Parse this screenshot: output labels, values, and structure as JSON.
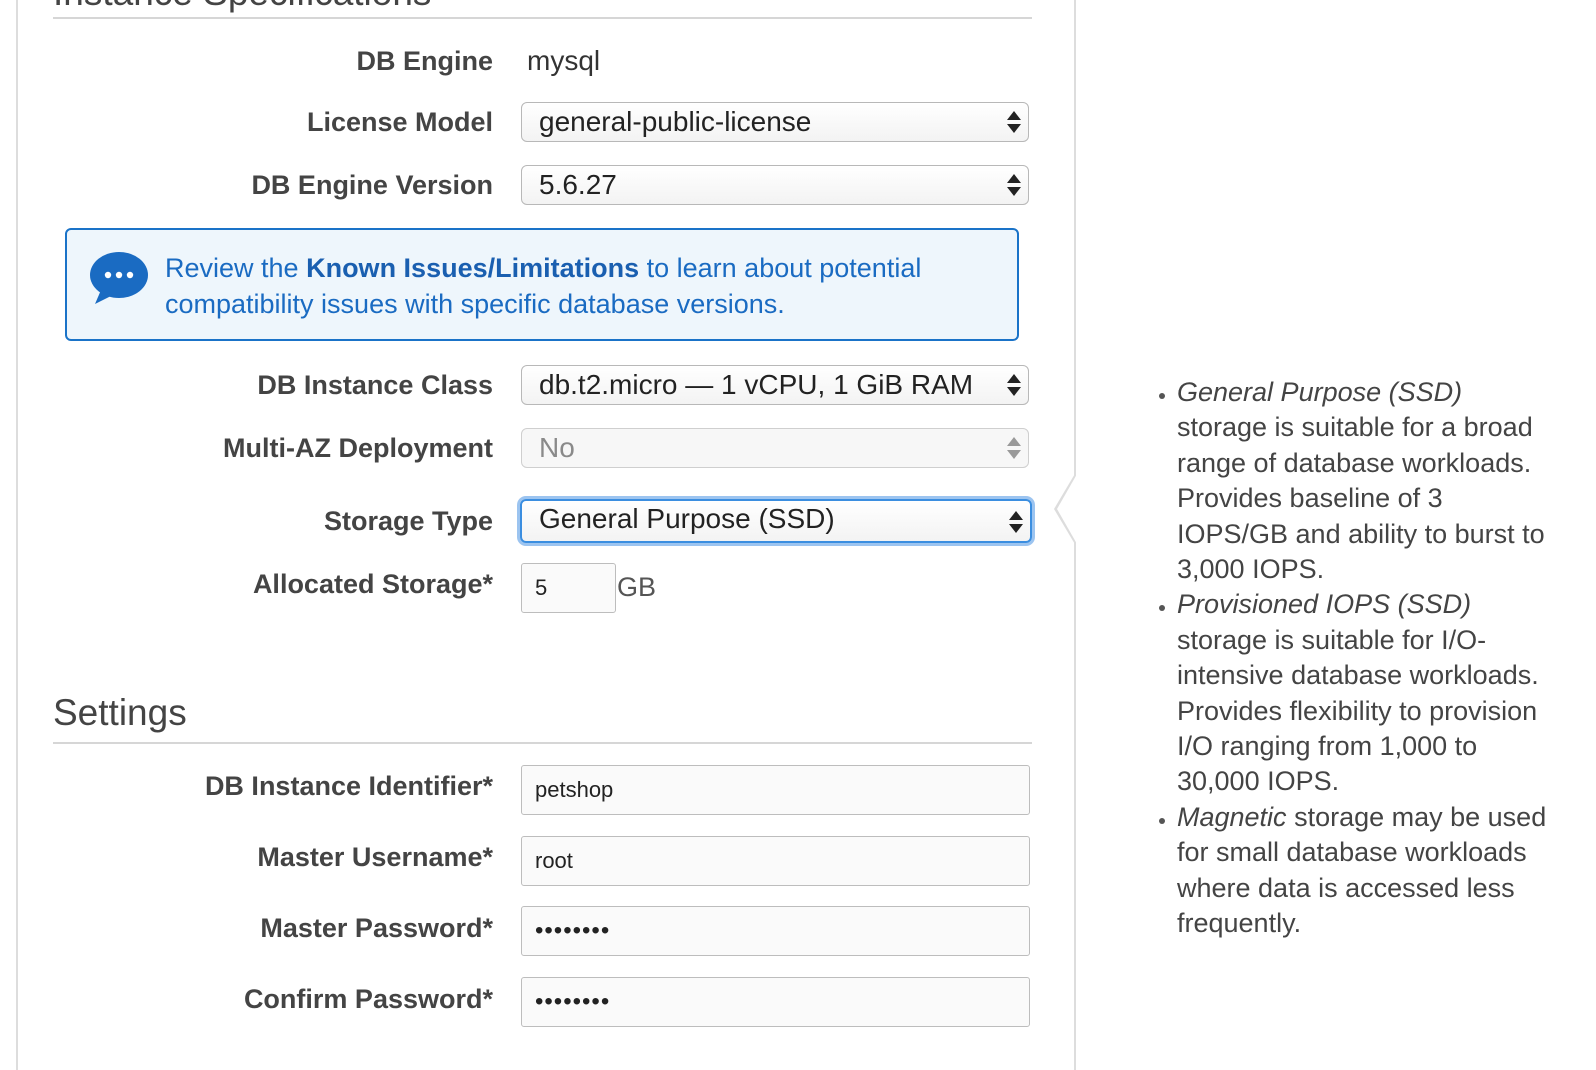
{
  "instance_specs": {
    "section_title": "Instance Specifications",
    "db_engine": {
      "label": "DB Engine",
      "value": "mysql"
    },
    "license_model": {
      "label": "License Model",
      "value": "general-public-license"
    },
    "db_engine_version": {
      "label": "DB Engine Version",
      "value": "5.6.27"
    },
    "notice": {
      "prefix": "Review the ",
      "link": "Known Issues/Limitations",
      "suffix": " to learn about potential compatibility issues with specific database versions.",
      "icon": "speech-bubble-icon"
    },
    "db_instance_class": {
      "label": "DB Instance Class",
      "value": "db.t2.micro — 1 vCPU, 1 GiB RAM"
    },
    "multi_az": {
      "label": "Multi-AZ Deployment",
      "value": "No"
    },
    "storage_type": {
      "label": "Storage Type",
      "value": "General Purpose (SSD)"
    },
    "allocated_storage": {
      "label": "Allocated Storage*",
      "value": "5",
      "unit": "GB"
    }
  },
  "settings": {
    "section_title": "Settings",
    "db_instance_identifier": {
      "label": "DB Instance Identifier*",
      "value": "petshop"
    },
    "master_username": {
      "label": "Master Username*",
      "value": "root"
    },
    "master_password": {
      "label": "Master Password*",
      "value": "••••••••"
    },
    "confirm_password": {
      "label": "Confirm Password*",
      "value": "••••••••"
    }
  },
  "help": {
    "items": [
      {
        "term": "General Purpose (SSD)",
        "text": " storage is suitable for a broad range of database workloads. Provides baseline of 3 IOPS/GB and ability to burst to 3,000 IOPS."
      },
      {
        "term": "Provisioned IOPS (SSD)",
        "text": " storage is suitable for I/O-intensive database workloads. Provides flexibility to provision I/O ranging from 1,000 to 30,000 IOPS."
      },
      {
        "term": "Magnetic",
        "text": " storage may be used for small database workloads where data is accessed less frequently."
      }
    ]
  },
  "colors": {
    "accent": "#1a73c8",
    "notice_background": "#eef6fc",
    "focus_ring": "#3b8ee0"
  }
}
